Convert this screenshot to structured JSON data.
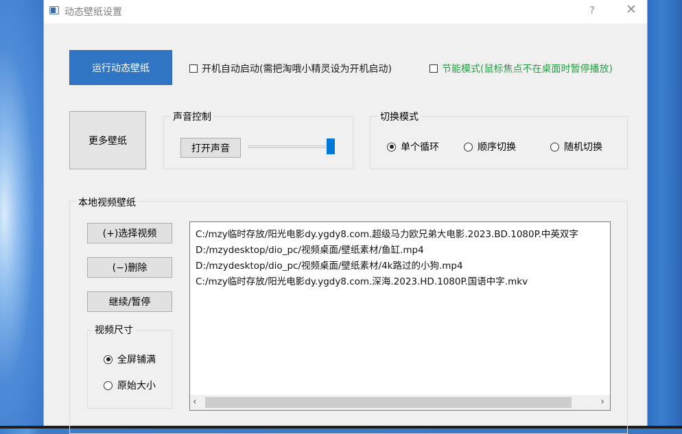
{
  "window": {
    "title": "动态壁纸设置",
    "help": "?",
    "close": "✕"
  },
  "top": {
    "run_button": "运行动态壁纸",
    "autostart_label": "开机自动启动(需把淘哦小精灵设为开机启动)",
    "autostart_checked": false,
    "power_save_label": "节能模式(鼠标焦点不在桌面时暂停播放)",
    "power_save_checked": false,
    "power_save_color": "#2e9a4a"
  },
  "more_button": "更多壁纸",
  "sound": {
    "group_title": "声音控制",
    "toggle_button": "打开声音",
    "volume_percent": 100
  },
  "switch_mode": {
    "group_title": "切换模式",
    "options": [
      "单个循环",
      "顺序切换",
      "随机切换"
    ],
    "selected": "单个循环"
  },
  "local": {
    "group_title": "本地视频壁纸",
    "select_button": "(+)选择视频",
    "delete_button": "(−)删除",
    "pause_button": "继续/暂停",
    "size_group_title": "视频尺寸",
    "size_options": [
      "全屏铺满",
      "原始大小"
    ],
    "size_selected": "全屏铺满",
    "files": [
      "C:/mzy临时存放/阳光电影dy.ygdy8.com.超级马力欧兄弟大电影.2023.BD.1080P.中英双字",
      "D:/mzydesktop/dio_pc/视频桌面/壁纸素材/鱼缸.mp4",
      "D:/mzydesktop/dio_pc/视频桌面/壁纸素材/4k路过的小狗.mp4",
      "C:/mzy临时存放/阳光电影dy.ygdy8.com.深海.2023.HD.1080P.国语中字.mkv"
    ]
  },
  "colors": {
    "accent": "#2f75c3",
    "window_bg": "#f0f0f0",
    "slider": "#0078d7"
  }
}
